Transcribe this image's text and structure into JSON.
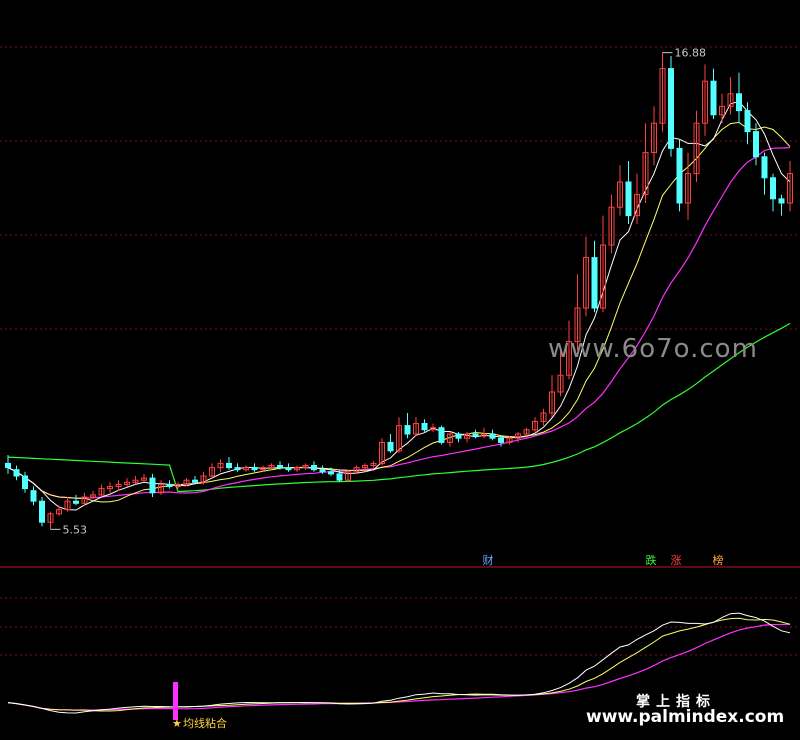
{
  "chart_data": [
    {
      "type": "candlestick",
      "price_range": [
        4.8,
        17.8
      ],
      "labels": {
        "high": "16.88",
        "low": "5.53"
      },
      "colors": {
        "up": "#ff4040",
        "down": "#54ffff",
        "ma1": "#ffffff",
        "ma2": "#ffff66",
        "ma3": "#ff30ff",
        "ma4": "#30ff30",
        "grid": "#7a1020"
      },
      "candles": [
        [
          7.1,
          7.0,
          7.3,
          6.85
        ],
        [
          6.95,
          6.8,
          7.05,
          6.7
        ],
        [
          6.8,
          6.5,
          6.9,
          6.4
        ],
        [
          6.45,
          6.2,
          6.55,
          6.1
        ],
        [
          6.2,
          5.7,
          6.3,
          5.6
        ],
        [
          5.7,
          5.9,
          5.95,
          5.53
        ],
        [
          5.9,
          6.0,
          6.1,
          5.85
        ],
        [
          6.0,
          6.2,
          6.3,
          5.95
        ],
        [
          6.2,
          6.15,
          6.35,
          6.1
        ],
        [
          6.15,
          6.3,
          6.4,
          6.1
        ],
        [
          6.3,
          6.35,
          6.45,
          6.25
        ],
        [
          6.35,
          6.5,
          6.6,
          6.3
        ],
        [
          6.5,
          6.55,
          6.65,
          6.4
        ],
        [
          6.55,
          6.6,
          6.7,
          6.45
        ],
        [
          6.6,
          6.65,
          6.75,
          6.55
        ],
        [
          6.65,
          6.7,
          6.8,
          6.6
        ],
        [
          6.7,
          6.75,
          6.85,
          6.65
        ],
        [
          6.75,
          6.4,
          6.85,
          6.3
        ],
        [
          6.4,
          6.6,
          6.7,
          6.35
        ],
        [
          6.6,
          6.55,
          6.7,
          6.5
        ],
        [
          6.55,
          6.6,
          6.65,
          6.5
        ],
        [
          6.6,
          6.7,
          6.75,
          6.55
        ],
        [
          6.7,
          6.65,
          6.8,
          6.6
        ],
        [
          6.65,
          6.8,
          6.9,
          6.6
        ],
        [
          6.8,
          7.0,
          7.1,
          6.75
        ],
        [
          7.0,
          7.1,
          7.2,
          6.9
        ],
        [
          7.1,
          7.0,
          7.25,
          6.95
        ],
        [
          7.0,
          6.95,
          7.1,
          6.9
        ],
        [
          6.95,
          7.0,
          7.05,
          6.9
        ],
        [
          7.0,
          6.95,
          7.1,
          6.9
        ],
        [
          6.95,
          7.0,
          7.05,
          6.9
        ],
        [
          7.0,
          7.05,
          7.1,
          6.95
        ],
        [
          7.05,
          7.0,
          7.15,
          6.95
        ],
        [
          7.0,
          6.95,
          7.1,
          6.9
        ],
        [
          6.95,
          7.0,
          7.05,
          6.9
        ],
        [
          7.0,
          7.05,
          7.1,
          6.95
        ],
        [
          7.05,
          6.95,
          7.15,
          6.9
        ],
        [
          6.95,
          6.9,
          7.05,
          6.85
        ],
        [
          6.9,
          6.85,
          7.0,
          6.8
        ],
        [
          6.85,
          6.7,
          6.95,
          6.65
        ],
        [
          6.7,
          6.9,
          6.95,
          6.65
        ],
        [
          6.9,
          7.0,
          7.05,
          6.85
        ],
        [
          7.0,
          7.05,
          7.1,
          6.95
        ],
        [
          7.05,
          7.1,
          7.15,
          7.0
        ],
        [
          7.1,
          7.6,
          7.7,
          7.05
        ],
        [
          7.6,
          7.4,
          7.8,
          7.35
        ],
        [
          7.4,
          8.0,
          8.2,
          7.35
        ],
        [
          8.0,
          7.8,
          8.3,
          7.7
        ],
        [
          7.8,
          8.05,
          8.2,
          7.75
        ],
        [
          8.05,
          7.9,
          8.15,
          7.85
        ],
        [
          7.9,
          7.95,
          8.05,
          7.85
        ],
        [
          7.95,
          7.6,
          8.0,
          7.55
        ],
        [
          7.6,
          7.8,
          7.85,
          7.5
        ],
        [
          7.8,
          7.7,
          7.85,
          7.6
        ],
        [
          7.7,
          7.8,
          7.85,
          7.6
        ],
        [
          7.8,
          7.75,
          7.9,
          7.7
        ],
        [
          7.75,
          7.8,
          7.95,
          7.7
        ],
        [
          7.8,
          7.7,
          7.9,
          7.65
        ],
        [
          7.7,
          7.6,
          7.75,
          7.5
        ],
        [
          7.6,
          7.7,
          7.75,
          7.55
        ],
        [
          7.7,
          7.8,
          7.85,
          7.6
        ],
        [
          7.8,
          7.9,
          7.95,
          7.7
        ],
        [
          7.9,
          8.1,
          8.2,
          7.85
        ],
        [
          8.1,
          8.3,
          8.4,
          8.0
        ],
        [
          8.3,
          8.8,
          9.2,
          8.2
        ],
        [
          8.8,
          9.2,
          9.8,
          8.7
        ],
        [
          9.2,
          10.0,
          10.5,
          9.1
        ],
        [
          10.0,
          10.8,
          11.6,
          9.8
        ],
        [
          10.8,
          12.0,
          12.5,
          10.6
        ],
        [
          12.0,
          10.8,
          12.4,
          10.7
        ],
        [
          10.8,
          12.3,
          13.0,
          10.7
        ],
        [
          12.3,
          13.2,
          13.5,
          12.1
        ],
        [
          13.2,
          13.8,
          14.2,
          13.0
        ],
        [
          13.8,
          13.0,
          14.3,
          12.8
        ],
        [
          13.0,
          13.5,
          14.0,
          12.8
        ],
        [
          13.5,
          14.5,
          15.2,
          13.3
        ],
        [
          14.5,
          15.2,
          15.6,
          14.2
        ],
        [
          15.2,
          16.5,
          16.88,
          15.0
        ],
        [
          16.5,
          14.6,
          16.8,
          14.4
        ],
        [
          14.6,
          13.3,
          14.8,
          13.1
        ],
        [
          13.3,
          14.0,
          14.5,
          12.9
        ],
        [
          14.0,
          15.2,
          15.5,
          13.8
        ],
        [
          15.2,
          16.2,
          16.6,
          14.9
        ],
        [
          16.2,
          15.4,
          16.5,
          15.3
        ],
        [
          15.4,
          15.6,
          15.9,
          15.2
        ],
        [
          15.6,
          15.9,
          16.3,
          15.4
        ],
        [
          15.9,
          15.5,
          16.4,
          15.2
        ],
        [
          15.5,
          15.0,
          15.7,
          14.7
        ],
        [
          15.0,
          14.4,
          15.2,
          14.2
        ],
        [
          14.4,
          13.9,
          14.5,
          13.5
        ],
        [
          13.9,
          13.4,
          14.0,
          13.1
        ],
        [
          13.4,
          13.3,
          13.5,
          13.0
        ],
        [
          13.3,
          14.0,
          14.3,
          13.1
        ]
      ],
      "events": [
        "财",
        "跌",
        "涨",
        "榜"
      ]
    },
    {
      "type": "line",
      "signal_label": "均线粘合"
    }
  ],
  "watermark": {
    "site": "www.6o7o.com",
    "brand": "掌上指标",
    "url": "www.palmindex.com"
  }
}
